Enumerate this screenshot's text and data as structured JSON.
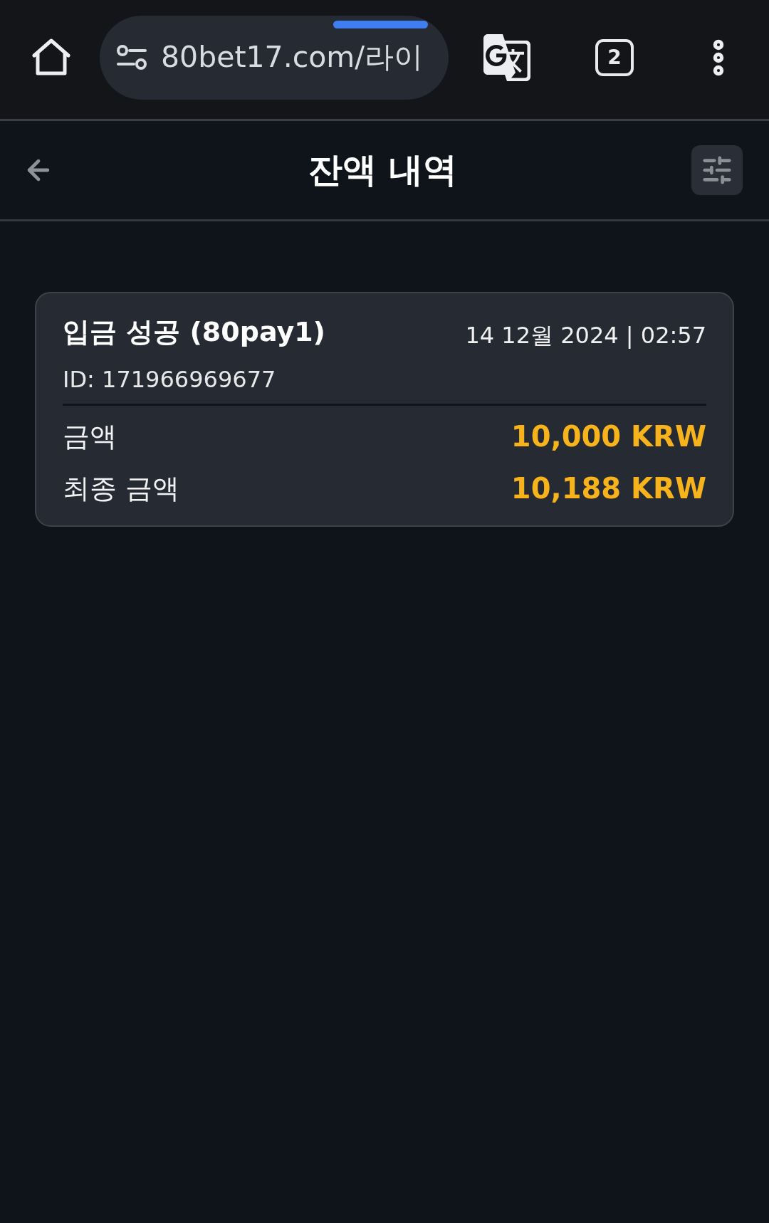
{
  "browser": {
    "url": "80bet17.com/라이",
    "tab_count": "2"
  },
  "header": {
    "title": "잔액 내역"
  },
  "transactions": [
    {
      "title": "입금 성공 (80pay1)",
      "datetime": "14 12월 2024 | 02:57",
      "id": "ID: 171966969677",
      "rows": [
        {
          "label": "금액",
          "value": "10,000 KRW"
        },
        {
          "label": "최종 금액",
          "value": "10,188 KRW"
        }
      ]
    }
  ]
}
